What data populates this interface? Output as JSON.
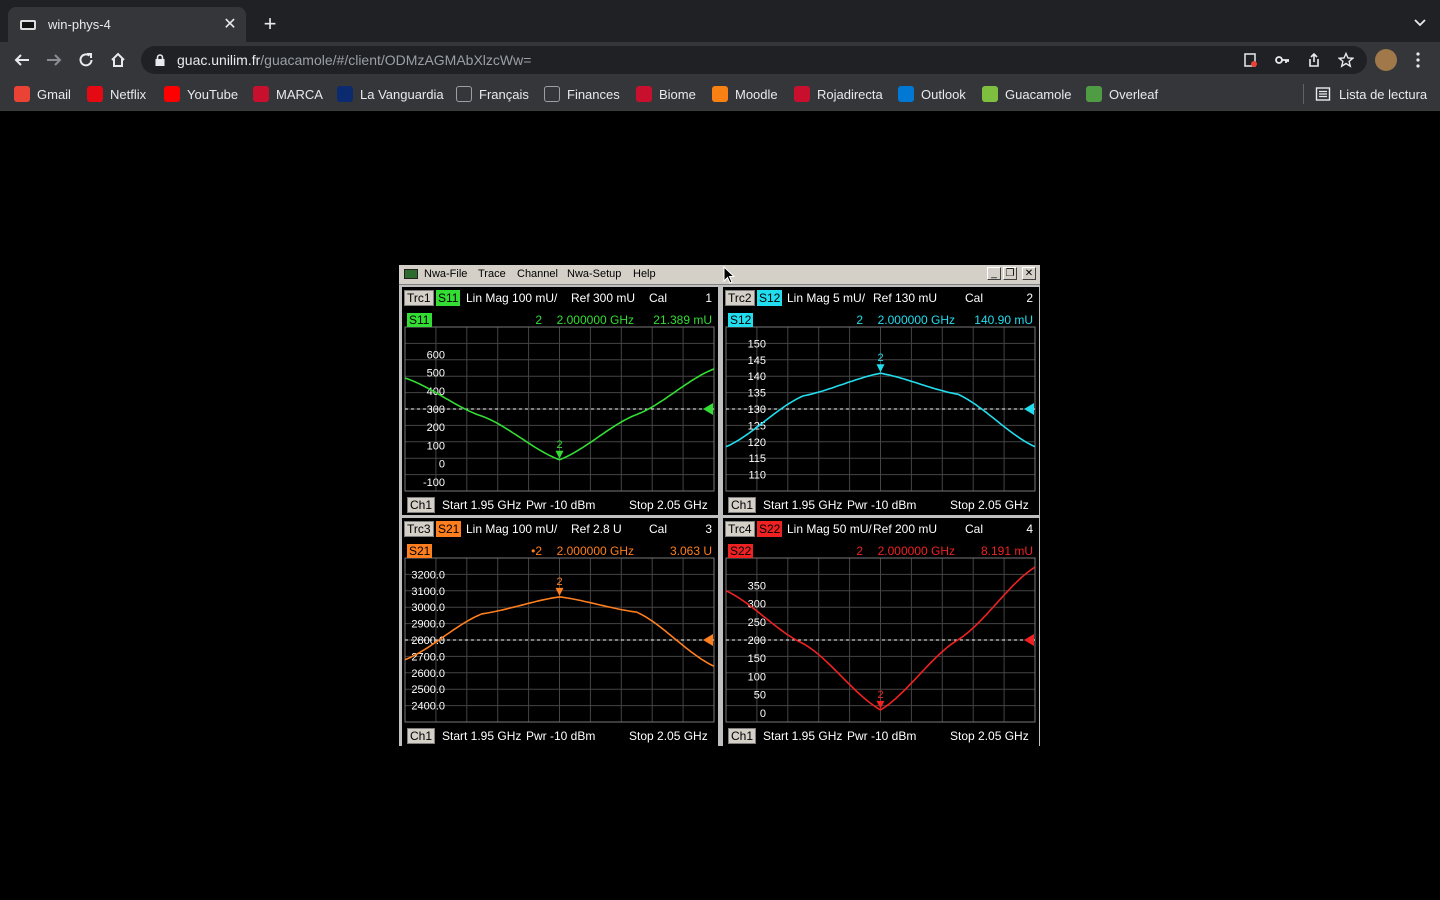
{
  "browser": {
    "tab_title": "win-phys-4",
    "url_host": "guac.unilim.fr",
    "url_path": "/guacamole/#/client/ODMzAGMAbXlzcWw=",
    "bookmarks": [
      {
        "label": "Gmail",
        "color": "#ea4335"
      },
      {
        "label": "Netflix",
        "color": "#e50914"
      },
      {
        "label": "YouTube",
        "color": "#ff0000"
      },
      {
        "label": "MARCA",
        "color": "#c8102e"
      },
      {
        "label": "La Vanguardia",
        "color": "#0b2a6f"
      },
      {
        "label": "Français",
        "color": "#9aa0a6"
      },
      {
        "label": "Finances",
        "color": "#9aa0a6"
      },
      {
        "label": "Biome",
        "color": "#c8102e"
      },
      {
        "label": "Moodle",
        "color": "#f98012"
      },
      {
        "label": "Rojadirecta",
        "color": "#c8102e"
      },
      {
        "label": "Outlook",
        "color": "#0078d4"
      },
      {
        "label": "Guacamole",
        "color": "#7fbf3f"
      },
      {
        "label": "Overleaf",
        "color": "#4f9c45"
      }
    ],
    "reading_list": "Lista de lectura"
  },
  "nwa": {
    "menu": [
      "Nwa-File",
      "Trace",
      "Channel",
      "Nwa-Setup",
      "Help"
    ],
    "footer": {
      "ch": "Ch1",
      "start": "Start  1.95 GHz",
      "pwr": "Pwr  -10 dBm",
      "stop": "Stop  2.05 GHz"
    },
    "traces": [
      {
        "trc": "Trc1",
        "sparam": "S11",
        "format": "Lin Mag  100 mU/",
        "ref": "Ref 300 mU",
        "cal": "Cal",
        "num": "1",
        "marker": {
          "id": "2",
          "freq": "2.000000 GHz",
          "value": "21.389 mU"
        },
        "color": "#33dd33",
        "ticks": [
          "600",
          "500",
          "400",
          "300",
          "200",
          "100",
          "0",
          "-100"
        ]
      },
      {
        "trc": "Trc2",
        "sparam": "S12",
        "format": "Lin Mag  5 mU/",
        "ref": "Ref 130 mU",
        "cal": "Cal",
        "num": "2",
        "marker": {
          "id": "2",
          "freq": "2.000000 GHz",
          "value": "140.90 mU"
        },
        "color": "#22ddee",
        "ticks": [
          "150",
          "145",
          "140",
          "135",
          "130",
          "125",
          "120",
          "115",
          "110"
        ]
      },
      {
        "trc": "Trc3",
        "sparam": "S21",
        "format": "Lin Mag  100 mU/",
        "ref": "Ref 2.8 U",
        "cal": "Cal",
        "num": "3",
        "marker": {
          "id": "•2",
          "freq": "2.000000 GHz",
          "value": "3.063 U"
        },
        "color": "#ff7f1f",
        "ticks": [
          "3200.0",
          "3100.0",
          "3000.0",
          "2900.0",
          "2800.0",
          "2700.0",
          "2600.0",
          "2500.0",
          "2400.0"
        ]
      },
      {
        "trc": "Trc4",
        "sparam": "S22",
        "format": "Lin Mag  50 mU/",
        "ref": "Ref 200 mU",
        "cal": "Cal",
        "num": "4",
        "marker": {
          "id": "2",
          "freq": "2.000000 GHz",
          "value": "8.191 mU"
        },
        "color": "#ee2222",
        "ticks": [
          "350",
          "300",
          "250",
          "200",
          "150",
          "100",
          "50",
          "0"
        ]
      }
    ]
  },
  "chart_data": [
    {
      "type": "line",
      "title": "S11",
      "xlabel": "",
      "ylabel": "",
      "x_range_ghz": [
        1.95,
        2.05
      ],
      "ylim": [
        -150,
        750
      ],
      "reference": 300,
      "grid": true,
      "series": [
        {
          "name": "S11",
          "x": [
            1.95,
            1.975,
            2.0,
            2.025,
            2.05
          ],
          "values": [
            470,
            260,
            21.389,
            270,
            520
          ]
        }
      ],
      "marker": {
        "x": 2.0,
        "y": 21.389
      }
    },
    {
      "type": "line",
      "title": "S12",
      "xlabel": "",
      "ylabel": "",
      "x_range_ghz": [
        1.95,
        2.05
      ],
      "ylim": [
        105,
        155
      ],
      "reference": 130,
      "grid": true,
      "series": [
        {
          "name": "S12",
          "x": [
            1.95,
            1.975,
            2.0,
            2.025,
            2.05
          ],
          "values": [
            118.5,
            134,
            140.9,
            134.5,
            118.5
          ]
        }
      ],
      "marker": {
        "x": 2.0,
        "y": 140.9
      }
    },
    {
      "type": "line",
      "title": "S21",
      "xlabel": "",
      "ylabel": "",
      "x_range_ghz": [
        1.95,
        2.05
      ],
      "ylim": [
        2300,
        3300
      ],
      "reference": 2800,
      "grid": true,
      "series": [
        {
          "name": "S21",
          "x": [
            1.95,
            1.975,
            2.0,
            2.025,
            2.05
          ],
          "values": [
            2680,
            2960,
            3063,
            2970,
            2640
          ]
        }
      ],
      "marker": {
        "x": 2.0,
        "y": 3063
      }
    },
    {
      "type": "line",
      "title": "S22",
      "xlabel": "",
      "ylabel": "",
      "x_range_ghz": [
        1.95,
        2.05
      ],
      "ylim": [
        -25,
        425
      ],
      "reference": 200,
      "grid": true,
      "series": [
        {
          "name": "S22",
          "x": [
            1.95,
            1.975,
            2.0,
            2.025,
            2.05
          ],
          "values": [
            335,
            190,
            8.191,
            200,
            400
          ]
        }
      ],
      "marker": {
        "x": 2.0,
        "y": 8.191
      }
    }
  ]
}
